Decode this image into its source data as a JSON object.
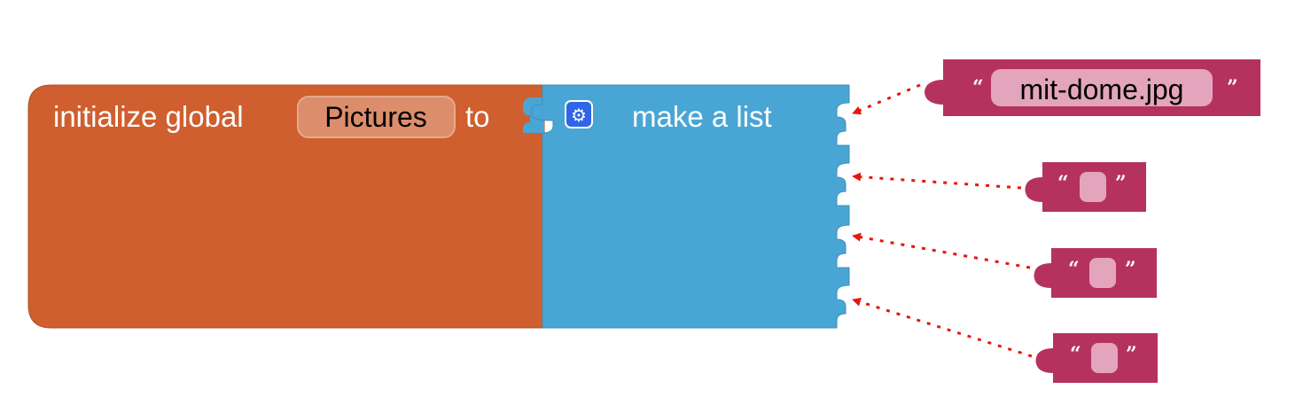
{
  "blocks": {
    "init_global": {
      "prefix": "initialize global",
      "variable_name": "Pictures",
      "suffix": "to",
      "color": "#cf5f2e",
      "field_color": "#dc8d6b"
    },
    "make_list": {
      "label": "make a list",
      "mutator_icon": "gear-icon",
      "color": "#49a6d4",
      "mutator_color": "#2f66e8"
    },
    "text_items": [
      {
        "value": "mit-dome.jpg",
        "open_quote": "“",
        "close_quote": "”"
      },
      {
        "value": "",
        "open_quote": "“",
        "close_quote": "”"
      },
      {
        "value": "",
        "open_quote": "“",
        "close_quote": "”"
      },
      {
        "value": "",
        "open_quote": "“",
        "close_quote": "”"
      }
    ],
    "text_color": "#b5325f",
    "text_field_color": "#e3a5bc"
  },
  "annotations": {
    "arrow_color": "#e8160e",
    "arrow_style": "dotted"
  }
}
